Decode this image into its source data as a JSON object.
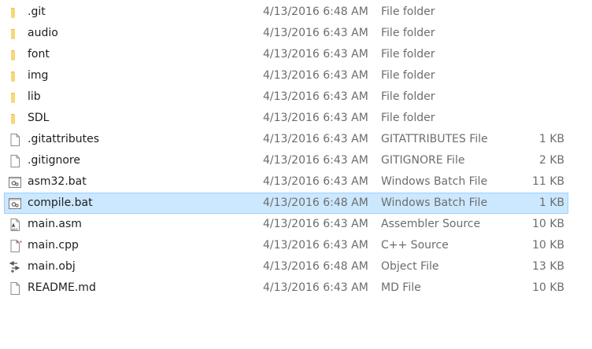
{
  "files": [
    {
      "name": ".git",
      "modified": "4/13/2016 6:48 AM",
      "type": "File folder",
      "size": "",
      "icon": "folder-icon"
    },
    {
      "name": "audio",
      "modified": "4/13/2016 6:43 AM",
      "type": "File folder",
      "size": "",
      "icon": "folder-icon"
    },
    {
      "name": "font",
      "modified": "4/13/2016 6:43 AM",
      "type": "File folder",
      "size": "",
      "icon": "folder-icon"
    },
    {
      "name": "img",
      "modified": "4/13/2016 6:43 AM",
      "type": "File folder",
      "size": "",
      "icon": "folder-icon"
    },
    {
      "name": "lib",
      "modified": "4/13/2016 6:43 AM",
      "type": "File folder",
      "size": "",
      "icon": "folder-icon"
    },
    {
      "name": "SDL",
      "modified": "4/13/2016 6:43 AM",
      "type": "File folder",
      "size": "",
      "icon": "folder-icon"
    },
    {
      "name": ".gitattributes",
      "modified": "4/13/2016 6:43 AM",
      "type": "GITATTRIBUTES File",
      "size": "1 KB",
      "icon": "file-icon"
    },
    {
      "name": ".gitignore",
      "modified": "4/13/2016 6:43 AM",
      "type": "GITIGNORE File",
      "size": "2 KB",
      "icon": "file-icon"
    },
    {
      "name": "asm32.bat",
      "modified": "4/13/2016 6:43 AM",
      "type": "Windows Batch File",
      "size": "11 KB",
      "icon": "batch-file-icon"
    },
    {
      "name": "compile.bat",
      "modified": "4/13/2016 6:48 AM",
      "type": "Windows Batch File",
      "size": "1 KB",
      "icon": "batch-file-icon",
      "selected": true
    },
    {
      "name": "main.asm",
      "modified": "4/13/2016 6:43 AM",
      "type": "Assembler Source",
      "size": "10 KB",
      "icon": "asm-file-icon"
    },
    {
      "name": "main.cpp",
      "modified": "4/13/2016 6:43 AM",
      "type": "C++ Source",
      "size": "10 KB",
      "icon": "cpp-file-icon"
    },
    {
      "name": "main.obj",
      "modified": "4/13/2016 6:48 AM",
      "type": "Object File",
      "size": "13 KB",
      "icon": "obj-file-icon"
    },
    {
      "name": "README.md",
      "modified": "4/13/2016 6:43 AM",
      "type": "MD File",
      "size": "10 KB",
      "icon": "file-icon"
    }
  ],
  "colors": {
    "folder": "#f8d775",
    "selection_bg": "#cce8ff",
    "selection_border": "#99d1ff",
    "name_text": "#1e1e1e",
    "meta_text": "#6d6d6d"
  }
}
